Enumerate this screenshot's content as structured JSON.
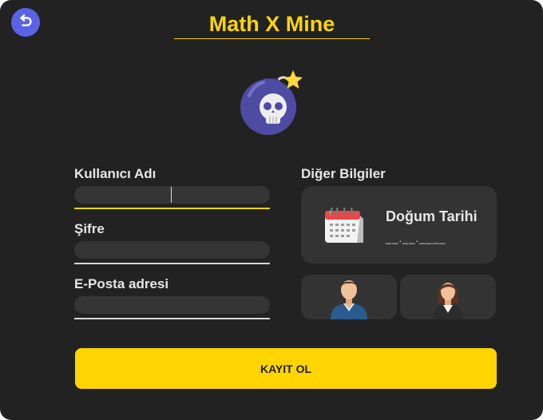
{
  "app": {
    "title": "Math X Mine"
  },
  "icons": {
    "back": "undo-arrow-icon",
    "logo": "skull-bomb-icon",
    "calendar": "calendar-icon",
    "male": "male-avatar-icon",
    "female": "female-avatar-icon"
  },
  "colors": {
    "accent": "#ffd500",
    "background": "#222222",
    "field": "#353535",
    "card": "#333333",
    "back_button": "#5a63e6"
  },
  "form": {
    "username_label": "Kullanıcı Adı",
    "username_value": "",
    "password_label": "Şifre",
    "password_value": "",
    "email_label": "E-Posta adresi",
    "email_value": "",
    "other_label": "Diğer Bilgiler",
    "birthdate_title": "Doğum Tarihi",
    "birthdate_value": "__.__.____"
  },
  "submit_label": "KAYIT OL"
}
